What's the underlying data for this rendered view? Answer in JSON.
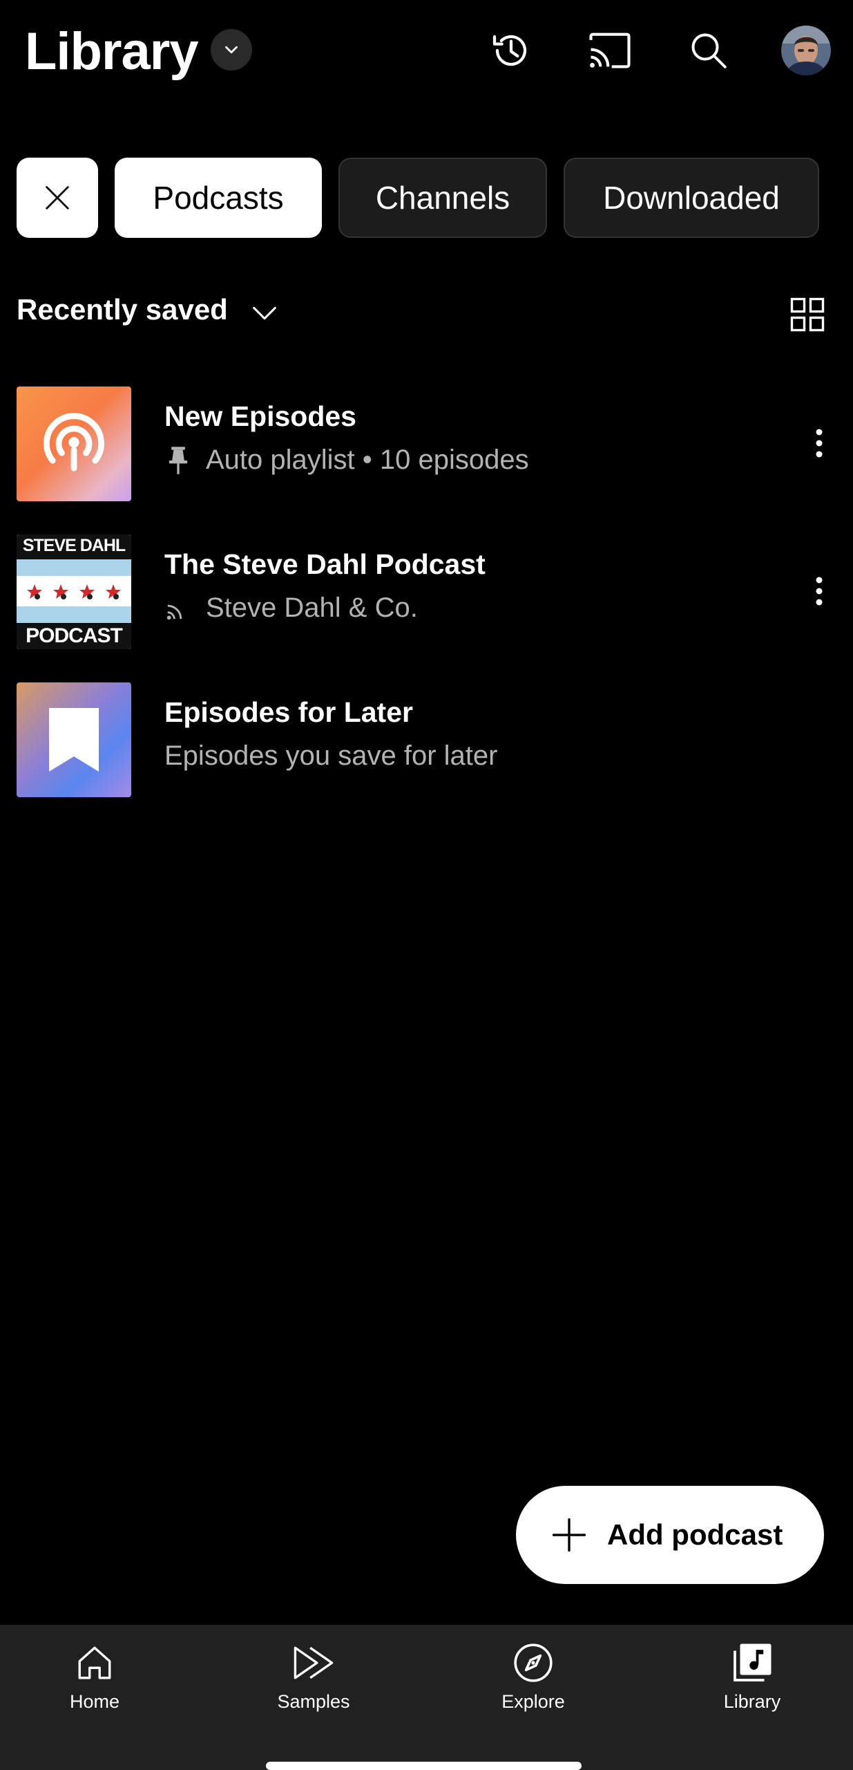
{
  "header": {
    "title": "Library",
    "icons": [
      "history-icon",
      "cast-icon",
      "search-icon",
      "avatar"
    ]
  },
  "chips": {
    "clear_icon": "close-icon",
    "items": [
      {
        "label": "Podcasts",
        "active": true
      },
      {
        "label": "Channels",
        "active": false
      },
      {
        "label": "Downloaded",
        "active": false
      }
    ]
  },
  "sort": {
    "label": "Recently saved"
  },
  "items": [
    {
      "title": "New Episodes",
      "subtitle": "Auto playlist • 10 episodes",
      "subtitle_icon": "pin-icon"
    },
    {
      "title": "The Steve Dahl Podcast",
      "subtitle": "Steve Dahl & Co.",
      "subtitle_icon": "podcast-feed-icon",
      "artwork_text_top": "STEVE DAHL",
      "artwork_text_bottom": "PODCAST"
    },
    {
      "title": "Episodes for Later",
      "subtitle": "Episodes you save for later"
    }
  ],
  "fab": {
    "label": "Add podcast"
  },
  "nav": [
    {
      "label": "Home",
      "icon": "home-icon"
    },
    {
      "label": "Samples",
      "icon": "samples-icon"
    },
    {
      "label": "Explore",
      "icon": "explore-icon"
    },
    {
      "label": "Library",
      "icon": "library-icon"
    }
  ],
  "colors": {
    "background": "#000000",
    "nav_background": "#212121",
    "secondary_text": "#b3b3b3"
  }
}
